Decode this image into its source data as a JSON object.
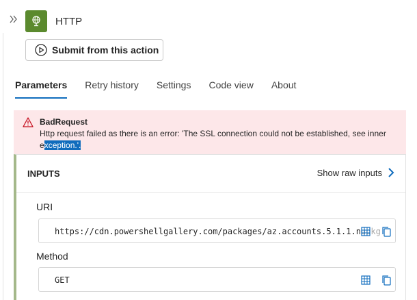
{
  "header": {
    "title": "HTTP",
    "submit_label": "Submit from this action"
  },
  "tabs": [
    {
      "label": "Parameters",
      "active": true
    },
    {
      "label": "Retry history",
      "active": false
    },
    {
      "label": "Settings",
      "active": false
    },
    {
      "label": "Code view",
      "active": false
    },
    {
      "label": "About",
      "active": false
    }
  ],
  "error": {
    "title": "BadRequest",
    "message_before": "Http request failed as there is an error: 'The SSL connection could not be established, see inner e",
    "message_selected": "xception.'.",
    "color": "#fde7e9"
  },
  "inputs": {
    "header": "INPUTS",
    "raw_link": "Show raw inputs",
    "accent_color": "#a4b88a",
    "fields": [
      {
        "label": "URI",
        "value": "https://cdn.powershellgallery.com/packages/az.accounts.5.1.1.nupkg"
      },
      {
        "label": "Method",
        "value": "GET"
      }
    ]
  },
  "colors": {
    "brand_green": "#5b8a2e",
    "link_blue": "#0f6cbd",
    "error_red": "#c50f1f"
  }
}
